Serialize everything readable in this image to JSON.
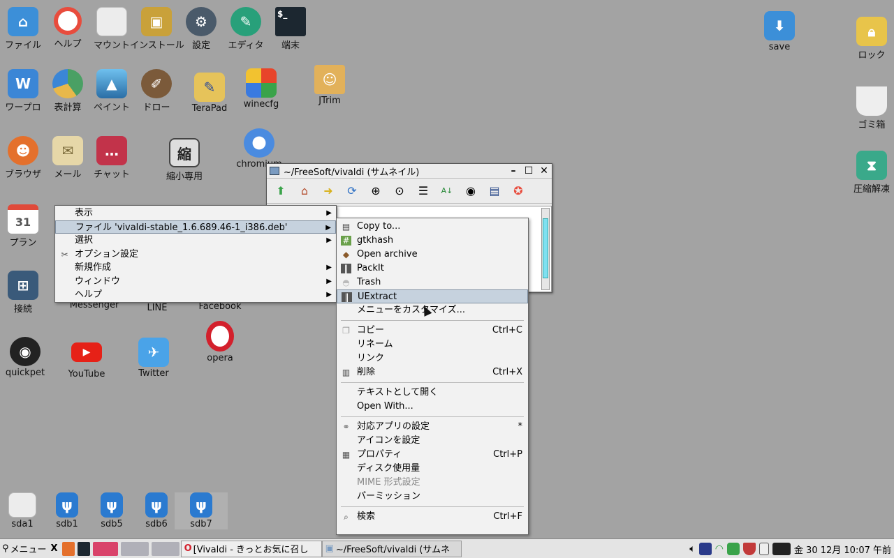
{
  "desktop_icons": [
    {
      "label": "ファイル",
      "icon": "home-folder-icon",
      "color": "#3c8fd8"
    },
    {
      "label": "ヘルプ",
      "icon": "lifebuoy-icon",
      "color": "#e84c3d"
    },
    {
      "label": "マウント",
      "icon": "drive-icon",
      "color": "#e8e8e8"
    },
    {
      "label": "インストール",
      "icon": "package-icon",
      "color": "#c9a13a"
    },
    {
      "label": "設定",
      "icon": "gear-icon",
      "color": "#4a5a6a"
    },
    {
      "label": "エディタ",
      "icon": "pen-icon",
      "color": "#28a07a"
    },
    {
      "label": "端末",
      "icon": "terminal-icon",
      "color": "#1c2730"
    },
    {
      "label": "ワープロ",
      "icon": "word-processor-icon",
      "color": "#3b86d6"
    },
    {
      "label": "表計算",
      "icon": "spreadsheet-icon",
      "color": "#4aa064"
    },
    {
      "label": "ペイント",
      "icon": "paint-icon",
      "color": "#3f9ed6"
    },
    {
      "label": "ドロー",
      "icon": "brush-icon",
      "color": "#7b5a3a"
    },
    {
      "label": "TeraPad",
      "icon": "notepad-icon",
      "color": "#e6c35a"
    },
    {
      "label": "winecfg",
      "icon": "wine-icon",
      "color": "#9e2a2a"
    },
    {
      "label": "JTrim",
      "icon": "jtrim-icon",
      "color": "#e2b15a"
    },
    {
      "label": "ブラウザ",
      "icon": "firefox-icon",
      "color": "#e4702c"
    },
    {
      "label": "メール",
      "icon": "mail-icon",
      "color": "#e6d7a8"
    },
    {
      "label": "チャット",
      "icon": "chat-icon",
      "color": "#c2334a"
    },
    {
      "label": "縮小専用",
      "icon": "shrink-icon",
      "color": "#dddddd"
    },
    {
      "label": "chromium",
      "icon": "chromium-icon",
      "color": "#4a8be0"
    },
    {
      "label": "プラン",
      "icon": "calendar-icon",
      "color": "#e04a3a"
    },
    {
      "label": "接続",
      "icon": "network-icon",
      "color": "#3a5a7a"
    },
    {
      "label": "Messenger",
      "icon": "messenger-icon",
      "color": "#3a7ae0"
    },
    {
      "label": "LINE",
      "icon": "line-icon",
      "color": "#39b54a"
    },
    {
      "label": "Facebook",
      "icon": "facebook-icon",
      "color": "#3b5998"
    },
    {
      "label": "quickpet",
      "icon": "quickpet-icon",
      "color": "#222222"
    },
    {
      "label": "YouTube",
      "icon": "youtube-icon",
      "color": "#e62117"
    },
    {
      "label": "Twitter",
      "icon": "twitter-icon",
      "color": "#4aa3e8"
    },
    {
      "label": "opera",
      "icon": "opera-icon",
      "color": "#d3202c"
    },
    {
      "label": "save",
      "icon": "download-icon",
      "color": "#3c8fd8"
    },
    {
      "label": "ロック",
      "icon": "lock-icon",
      "color": "#e8c44a"
    },
    {
      "label": "ゴミ箱",
      "icon": "trash-icon",
      "color": "#eeeeee"
    },
    {
      "label": "圧縮解凍",
      "icon": "archive-icon",
      "color": "#3aa98a"
    },
    {
      "label": "sda1",
      "icon": "drive-icon",
      "color": "#e8e8e8"
    },
    {
      "label": "sdb1",
      "icon": "usb-icon",
      "color": "#2a7ad0"
    },
    {
      "label": "sdb5",
      "icon": "usb-icon",
      "color": "#2a7ad0"
    },
    {
      "label": "sdb6",
      "icon": "usb-icon",
      "color": "#2a7ad0"
    },
    {
      "label": "sdb7",
      "icon": "usb-icon",
      "color": "#2a7ad0"
    }
  ],
  "fm_window": {
    "title": "~/FreeSoft/vivaldi (サムネイル)"
  },
  "menu_main": {
    "items": [
      {
        "label": "表示",
        "submenu": true
      },
      {
        "label": "ファイル 'vivaldi-stable_1.6.689.46-1_i386.deb'",
        "submenu": true,
        "selected": true
      },
      {
        "label": "選択",
        "submenu": true
      },
      {
        "label": "オプション設定",
        "submenu": false,
        "icon": "tools-icon"
      },
      {
        "label": "新規作成",
        "submenu": true
      },
      {
        "label": "ウィンドウ",
        "submenu": true
      },
      {
        "label": "ヘルプ",
        "submenu": true
      }
    ]
  },
  "menu_file": {
    "items": [
      {
        "label": "Copy to...",
        "icon": "copy-to-icon"
      },
      {
        "label": "gtkhash",
        "icon": "gtkhash-icon"
      },
      {
        "label": "Open archive",
        "icon": "open-archive-icon"
      },
      {
        "label": "PackIt",
        "icon": "packit-icon"
      },
      {
        "label": "Trash",
        "icon": "trash-icon"
      },
      {
        "label": "UExtract",
        "icon": "uextract-icon",
        "selected": true
      },
      {
        "label": "メニューをカスタマイズ..."
      },
      {
        "sep": true
      },
      {
        "label": "コピー",
        "accel": "Ctrl+C",
        "icon": "copy-icon"
      },
      {
        "label": "リネーム"
      },
      {
        "label": "リンク"
      },
      {
        "label": "削除",
        "accel": "Ctrl+X",
        "icon": "delete-icon"
      },
      {
        "sep": true
      },
      {
        "label": "テキストとして開く"
      },
      {
        "label": "Open With..."
      },
      {
        "sep": true
      },
      {
        "label": "対応アプリの設定",
        "accel": "*",
        "icon": "link-icon"
      },
      {
        "label": "アイコンを設定"
      },
      {
        "label": "プロパティ",
        "accel": "Ctrl+P",
        "icon": "properties-icon"
      },
      {
        "label": "ディスク使用量"
      },
      {
        "label": "MIME 形式設定",
        "disabled": true
      },
      {
        "label": "パーミッション"
      },
      {
        "sep": true
      },
      {
        "label": "検索",
        "accel": "Ctrl+F",
        "icon": "search-icon"
      }
    ]
  },
  "taskbar": {
    "menu_label": "メニュー",
    "task1": "[Vivaldi - きっとお気に召し",
    "task2": "~/FreeSoft/vivaldi (サムネ",
    "clock": "金 30 12月 10:07 午前"
  }
}
